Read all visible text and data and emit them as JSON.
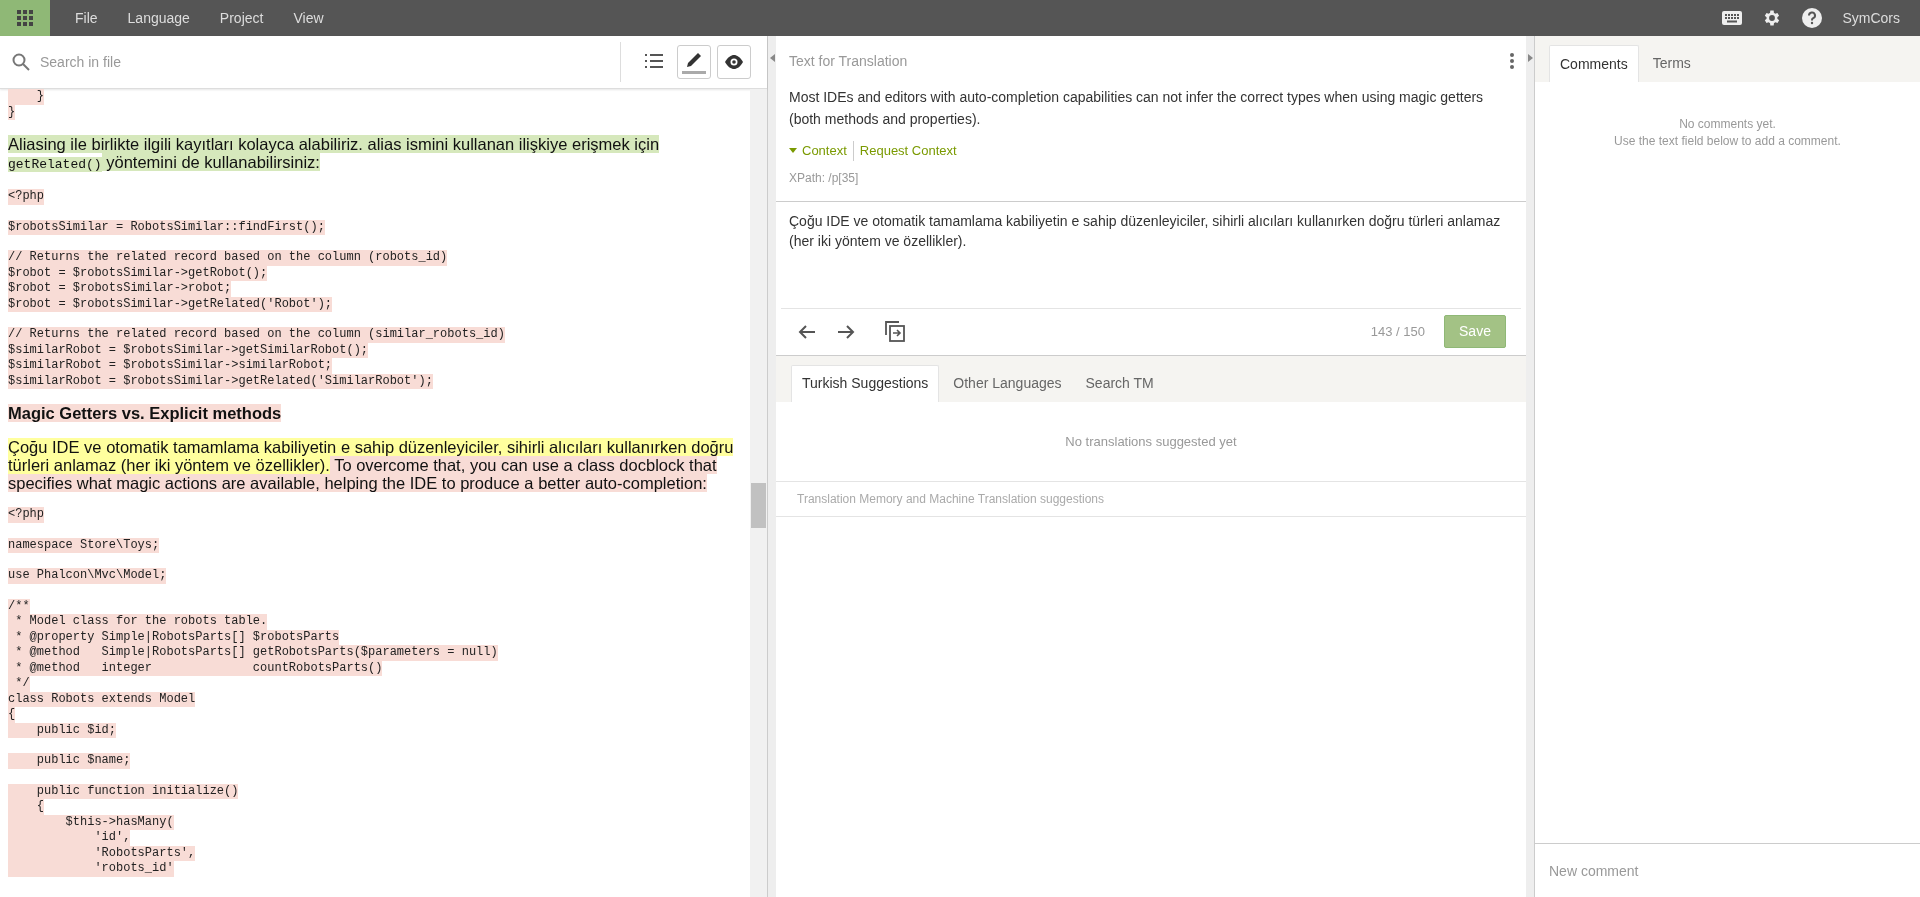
{
  "menu": {
    "items": [
      "File",
      "Language",
      "Project",
      "View"
    ],
    "user": "SymCors"
  },
  "search": {
    "placeholder": "Search in file"
  },
  "tools": [
    {
      "kind": "list",
      "on": false
    },
    {
      "kind": "edit",
      "on": true
    },
    {
      "kind": "preview",
      "on": true
    }
  ],
  "document": [
    {
      "kind": "code",
      "color": "#f8dcd6",
      "lines": [
        "    }",
        "}"
      ]
    },
    {
      "kind": "paragraph",
      "segments": [
        {
          "text": "Aliasing ile birlikte ilgili kayıtları kolayca alabiliriz. alias ismini kullanan ilişkiye erişmek için ",
          "color": "#d6e8bc",
          "code": false
        },
        {
          "text": "getRelated()",
          "color": "#d6e8bc",
          "code": true
        },
        {
          "text": " yöntemini de kullanabilirsiniz:",
          "color": "#d6e8bc",
          "code": false
        }
      ]
    },
    {
      "kind": "code",
      "color": "#f8dcd6",
      "lines": [
        "<?php"
      ]
    },
    {
      "kind": "code",
      "color": "#f8dcd6",
      "lines": [
        "$robotsSimilar = RobotsSimilar::findFirst();"
      ]
    },
    {
      "kind": "code",
      "color": "#f8dcd6",
      "lines": [
        "// Returns the related record based on the column (robots_id)",
        "$robot = $robotsSimilar->getRobot();",
        "$robot = $robotsSimilar->robot;",
        "$robot = $robotsSimilar->getRelated('Robot');"
      ]
    },
    {
      "kind": "code",
      "color": "#f8dcd6",
      "lines": [
        "// Returns the related record based on the column (similar_robots_id)",
        "$similarRobot = $robotsSimilar->getSimilarRobot();",
        "$similarRobot = $robotsSimilar->similarRobot;",
        "$similarRobot = $robotsSimilar->getRelated('SimilarRobot');"
      ]
    },
    {
      "kind": "heading",
      "segments": [
        {
          "text": "Magic Getters vs. Explicit methods",
          "color": "#f8dcd6",
          "code": false
        }
      ]
    },
    {
      "kind": "paragraph",
      "segments": [
        {
          "text": "Çoğu IDE ve otomatik tamamlama kabiliyetin e sahip düzenleyiciler, sihirli alıcıları kullanırken doğru türleri anlamaz (her iki yöntem ve özellikler).",
          "color": "#ffff9e",
          "code": false
        },
        {
          "text": " To overcome that, you can use a class docblock that specifies what magic actions are available, helping the IDE to produce a better auto-completion:",
          "color": "#f8dcd6",
          "code": false
        }
      ]
    },
    {
      "kind": "code",
      "color": "#f8dcd6",
      "lines": [
        "<?php"
      ]
    },
    {
      "kind": "code",
      "color": "#f8dcd6",
      "lines": [
        "namespace Store\\Toys;"
      ]
    },
    {
      "kind": "code",
      "color": "#f8dcd6",
      "lines": [
        "use Phalcon\\Mvc\\Model;"
      ]
    },
    {
      "kind": "code",
      "color": "#f8dcd6",
      "lines": [
        "/**",
        " * Model class for the robots table.",
        " * @property Simple|RobotsParts[] $robotsParts",
        " * @method   Simple|RobotsParts[] getRobotsParts($parameters = null)",
        " * @method   integer              countRobotsParts()",
        " */",
        "class Robots extends Model",
        "{",
        "    public $id;"
      ]
    },
    {
      "kind": "code",
      "color": "#f8dcd6",
      "lines": [
        "    public $name;"
      ]
    },
    {
      "kind": "code",
      "color": "#f8dcd6",
      "lines": [
        "    public function initialize()",
        "    {",
        "        $this->hasMany(",
        "            'id',",
        "            'RobotsParts',",
        "            'robots_id'"
      ]
    }
  ],
  "editor": {
    "title": "Text for Translation",
    "source": "Most IDEs and editors with auto-completion capabilities can not infer the correct types when using magic getters (both methods and properties).",
    "context": {
      "label": "Context",
      "expanded": true
    },
    "request_context": "Request Context",
    "xpath": "XPath: /p[35]",
    "translation": "Çoğu IDE ve otomatik tamamlama kabiliyetin e sahip düzenleyiciler, sihirli alıcıları kullanırken doğru türleri anlamaz (her iki yöntem ve özellikler).",
    "counter": "143 / 150",
    "save": "Save"
  },
  "suggestions": {
    "tabs": [
      {
        "label": "Turkish Suggestions",
        "selected": true
      },
      {
        "label": "Other Languages",
        "selected": false
      },
      {
        "label": "Search TM",
        "selected": false
      }
    ],
    "empty": "No translations suggested yet",
    "footer": "Translation Memory and Machine Translation suggestions"
  },
  "comments": {
    "tabs": [
      {
        "label": "Comments",
        "selected": true
      },
      {
        "label": "Terms",
        "selected": false
      }
    ],
    "empty": [
      "No comments yet.",
      "Use the text field below to add a comment."
    ],
    "placeholder": "New comment"
  }
}
